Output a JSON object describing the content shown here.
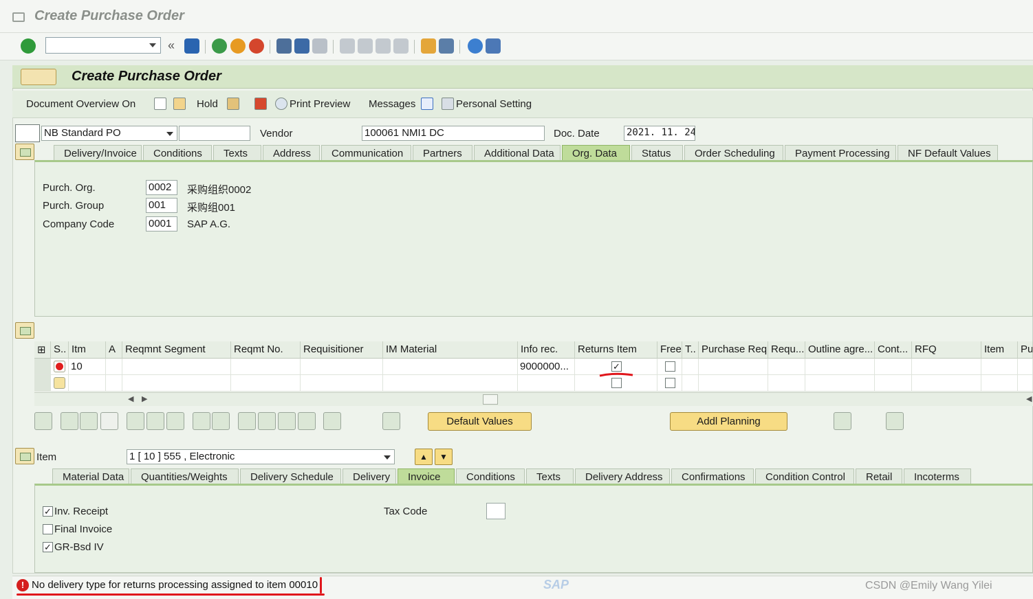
{
  "window": {
    "title": "Create Purchase Order"
  },
  "app": {
    "title": "Create Purchase Order",
    "toolbar": {
      "doc_overview": "Document Overview On",
      "hold": "Hold",
      "print_preview": "Print Preview",
      "messages": "Messages",
      "personal_setting": "Personal Setting"
    }
  },
  "header": {
    "po_type": "NB Standard PO",
    "po_number": "",
    "vendor_label": "Vendor",
    "vendor_value": "100061 NMI1 DC",
    "doc_date_label": "Doc. Date",
    "doc_date_value": "2021. 11. 24"
  },
  "header_tabs": [
    "Delivery/Invoice",
    "Conditions",
    "Texts",
    "Address",
    "Communication",
    "Partners",
    "Additional Data",
    "Org. Data",
    "Status",
    "Order Scheduling",
    "Payment Processing",
    "NF Default Values"
  ],
  "org_data": {
    "purch_org_label": "Purch. Org.",
    "purch_org_code": "0002",
    "purch_org_desc": "采购组织0002",
    "purch_group_label": "Purch. Group",
    "purch_group_code": "001",
    "purch_group_desc": "采购组001",
    "company_code_label": "Company Code",
    "company_code_code": "0001",
    "company_code_desc": "SAP A.G."
  },
  "items_table": {
    "columns": [
      "S..",
      "Itm",
      "A",
      "Reqmnt Segment",
      "Reqmt No.",
      "Requisitioner",
      "IM Material",
      "Info rec.",
      "Returns Item",
      "Free",
      "T..",
      "Purchase Req.",
      "Requ...",
      "Outline agre...",
      "Cont...",
      "RFQ",
      "Item",
      "Pu"
    ],
    "rows": [
      {
        "item": "10",
        "info_rec": "9000000...",
        "returns_item": true,
        "free": false
      },
      {
        "item": "",
        "info_rec": "",
        "returns_item": false,
        "free": false
      }
    ]
  },
  "item_buttons": {
    "default_values": "Default Values",
    "addl_planning": "Addl Planning"
  },
  "item_detail": {
    "label": "Item",
    "selected": "1 [ 10 ] 555 , Electronic",
    "tabs": [
      "Material Data",
      "Quantities/Weights",
      "Delivery Schedule",
      "Delivery",
      "Invoice",
      "Conditions",
      "Texts",
      "Delivery Address",
      "Confirmations",
      "Condition Control",
      "Retail",
      "Incoterms"
    ],
    "invoice": {
      "inv_receipt": "Inv. Receipt",
      "inv_receipt_checked": true,
      "final_invoice": "Final Invoice",
      "final_invoice_checked": false,
      "gr_bsd_iv": "GR-Bsd IV",
      "gr_bsd_iv_checked": true,
      "tax_code_label": "Tax Code",
      "tax_code_value": ""
    }
  },
  "status": {
    "message": "No delivery type for returns processing assigned to item 00010",
    "logo": "SAP",
    "watermark": "CSDN @Emily Wang Yilei"
  },
  "colors": {
    "accent_green": "#bfdc9a",
    "error_red": "#e0161b",
    "button_yellow": "#f7dc84"
  }
}
